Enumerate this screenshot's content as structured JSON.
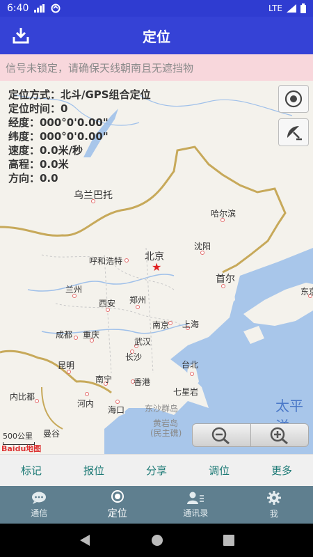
{
  "status": {
    "time": "6:40",
    "network": "LTE"
  },
  "app_bar": {
    "title": "定位",
    "download_icon": "download-icon"
  },
  "warning": "信号未锁定，请确保天线朝南且无遮挡物",
  "info": {
    "mode": "定位方式：北斗/GPS组合定位",
    "time": "定位时间：0",
    "longitude": "经度：000°0'0.00\"",
    "latitude": "纬度：000°0'0.00\"",
    "speed": "速度：0.0米/秒",
    "altitude": "高程：0.0米",
    "direction": "方向：0.0"
  },
  "map": {
    "cities": {
      "ulaanbaatar": "乌兰巴托",
      "harbin": "哈尔滨",
      "shenyang": "沈阳",
      "hohhot": "呼和浩特",
      "beijing": "北京",
      "seoul": "首尔",
      "lanzhou": "兰州",
      "xian": "西安",
      "zhengzhou": "郑州",
      "nanjing": "南京",
      "shanghai": "上海",
      "chengdu": "成都",
      "chongqing": "重庆",
      "wuhan": "武汉",
      "changsha": "长沙",
      "taipei": "台北",
      "kunming": "昆明",
      "nanning": "南宁",
      "hongkong": "香港",
      "qixingyan": "七星岩",
      "naypyidaw": "内比都",
      "hanoi": "河内",
      "haikou": "海口",
      "vientiane": "曼谷",
      "tokyo_partial": "东京"
    },
    "ocean": "太平洋",
    "dongsha": "东沙群岛",
    "huangyan_1": "黄岩岛",
    "huangyan_2": "(民主礁)",
    "scale": "500公里",
    "logo": "Baidu地图"
  },
  "actions": [
    "标记",
    "报位",
    "分享",
    "调位",
    "更多"
  ],
  "tabs": [
    {
      "label": "通信",
      "icon": "chat-icon"
    },
    {
      "label": "定位",
      "icon": "location-icon"
    },
    {
      "label": "通讯录",
      "icon": "contacts-icon"
    },
    {
      "label": "我",
      "icon": "gear-icon"
    }
  ]
}
